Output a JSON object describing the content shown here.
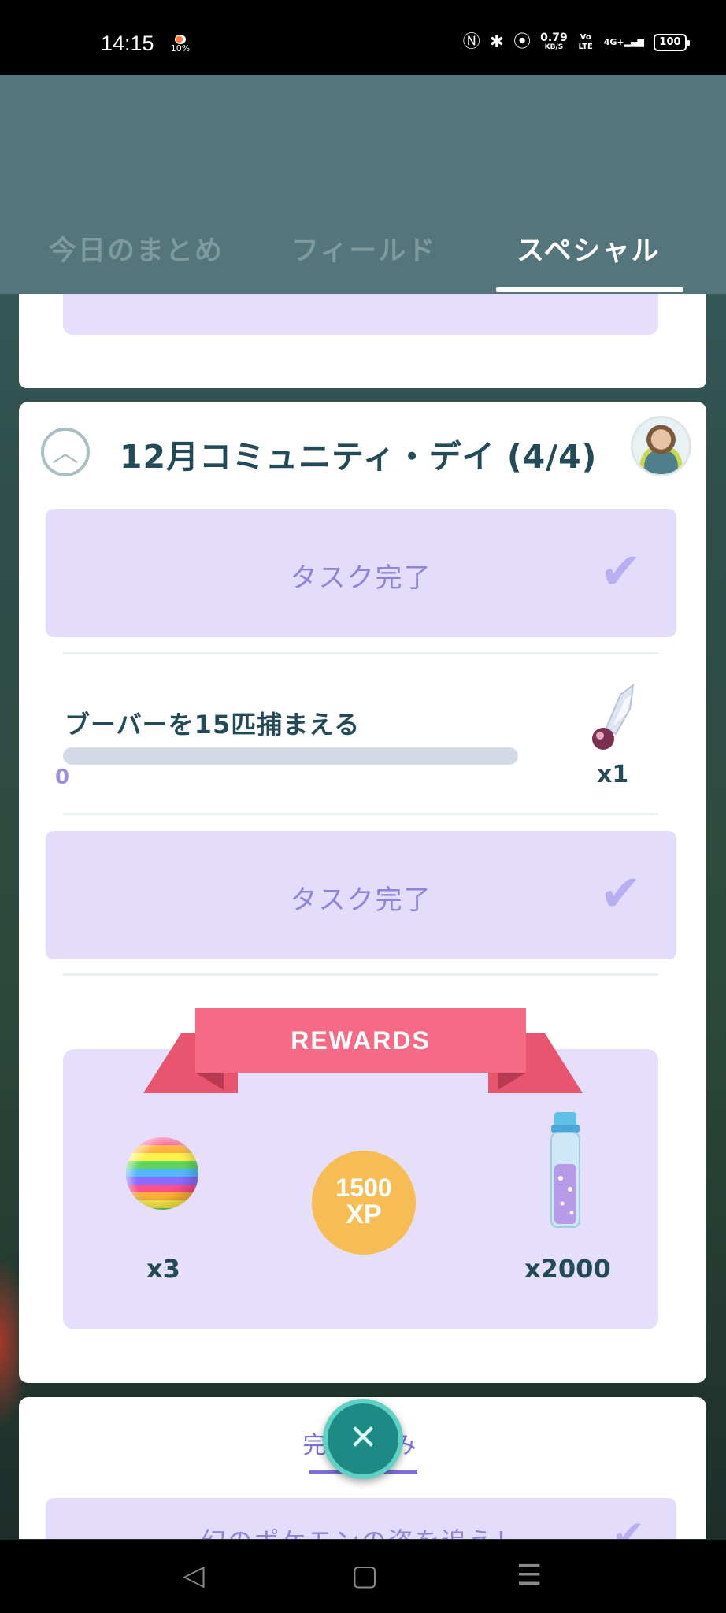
{
  "status_bar": {
    "time": "14:15",
    "weather_label": "10%",
    "speed_value": "0.79",
    "speed_unit": "KB/S",
    "volte": "Vo LTE",
    "network": "4G+",
    "battery": "100"
  },
  "tabs": [
    {
      "label": "今日のまとめ",
      "active": false
    },
    {
      "label": "フィールド",
      "active": false
    },
    {
      "label": "スペシャル",
      "active": true
    }
  ],
  "research_card": {
    "title": "12月コミュニティ・デイ (4/4)",
    "task_done_label_1": "タスク完了",
    "task_done_label_2": "タスク完了",
    "task": {
      "text": "ブーバーを15匹捕まえる",
      "progress_value": "0",
      "progress_fraction": 0,
      "reward_icon": "magmarizer-icon",
      "reward_count": "x1"
    },
    "rewards": {
      "banner": "REWARDS",
      "items": [
        {
          "icon": "rainbow-candy-icon",
          "count": "x3"
        },
        {
          "icon": "xp-icon",
          "amount": "1500",
          "unit": "XP"
        },
        {
          "icon": "stardust-tube-icon",
          "count": "x2000"
        }
      ]
    }
  },
  "bottom_card": {
    "tab_label": "完了済み",
    "task_label": "幻のポケモンの姿を追え！"
  },
  "colors": {
    "header": "#54757b",
    "task_done_bg": "#e4dcfb",
    "ribbon": "#f56b85",
    "xp": "#f7bd55",
    "title": "#234a57"
  }
}
